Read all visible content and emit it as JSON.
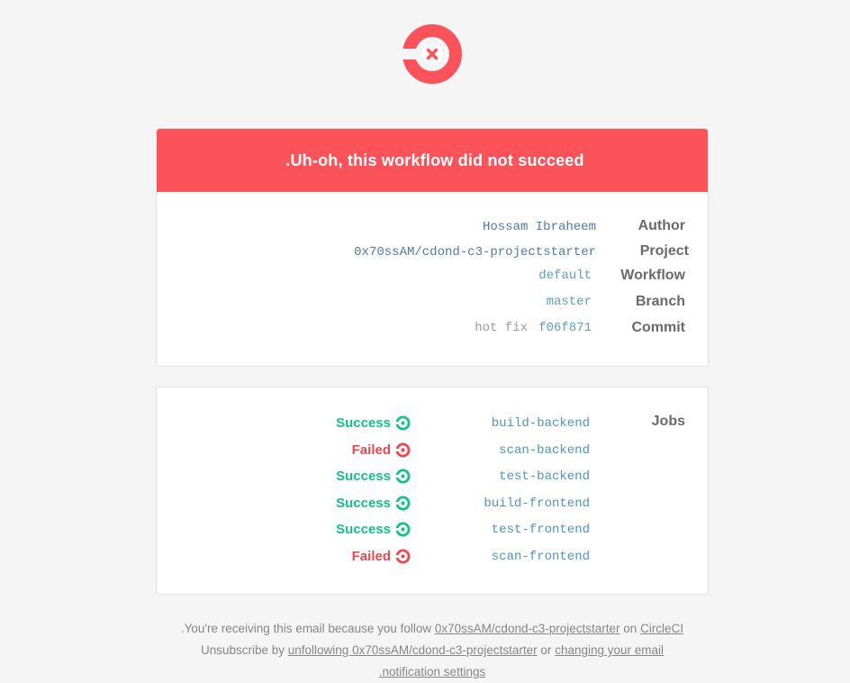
{
  "header": {
    "banner_title": ".Uh-oh, this workflow did not succeed",
    "brand_color": "#fb5359"
  },
  "details": {
    "author_label": "Author",
    "author_value": "Hossam Ibraheem",
    "project_label": "Project",
    "project_value": "0x70ssAM/cdond-c3-projectstarter",
    "workflow_label": "Workflow",
    "workflow_value": "default",
    "branch_label": "Branch",
    "branch_value": "master",
    "commit_label": "Commit",
    "commit_message": "hot fix",
    "commit_hash": "f06f871"
  },
  "jobs": {
    "label": "Jobs",
    "items": [
      {
        "status": "Success",
        "name": "build-backend"
      },
      {
        "status": "Failed",
        "name": "scan-backend"
      },
      {
        "status": "Success",
        "name": "test-backend"
      },
      {
        "status": "Success",
        "name": "build-frontend"
      },
      {
        "status": "Success",
        "name": "test-frontend"
      },
      {
        "status": "Failed",
        "name": "scan-frontend"
      }
    ],
    "success_color": "#15c08a",
    "failed_color": "#f0474e"
  },
  "footer": {
    "line1_prefix": ".You're receiving this email because you follow",
    "line1_project_link": "0x70ssAM/cdond-c3-projectstarter",
    "line1_on": "on",
    "line1_circleci_link": "CircleCI",
    "line2_prefix": "Unsubscribe by",
    "line2_unfollow_link": "unfollowing 0x70ssAM/cdond-c3-projectstarter",
    "line2_or": "or",
    "line2_change_link": "changing your email",
    "line3_link": ".notification settings"
  }
}
